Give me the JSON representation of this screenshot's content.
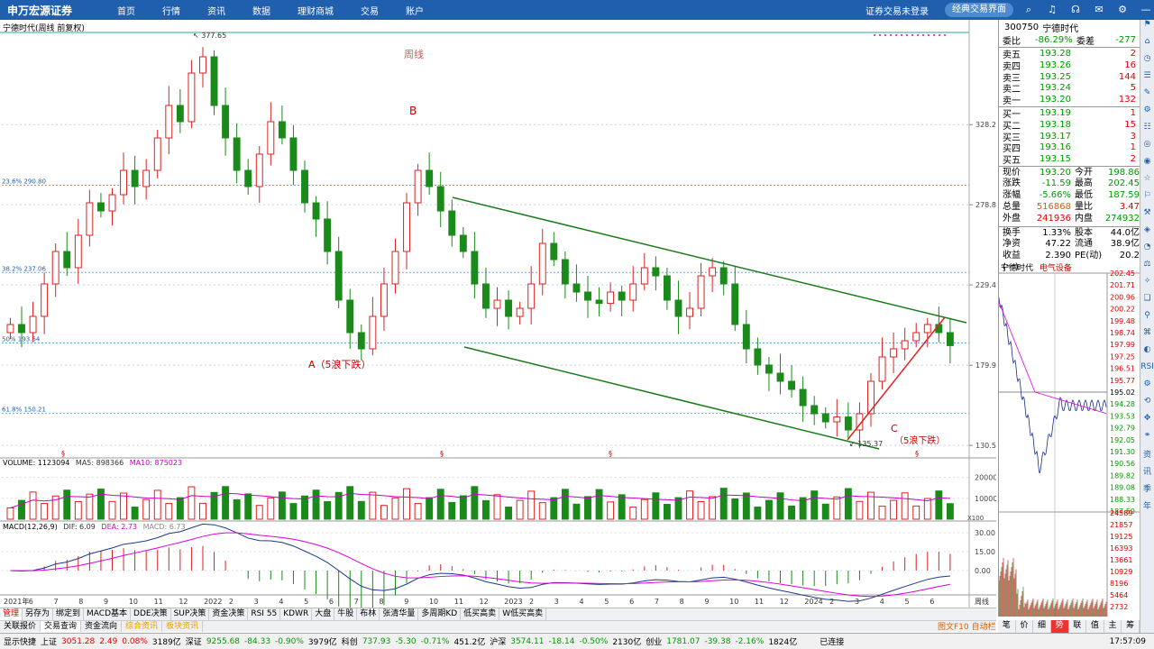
{
  "brand": {
    "logo": "申万宏源证券"
  },
  "nav": [
    "首页",
    "行情",
    "资讯",
    "数据",
    "理财商城",
    "交易",
    "账户"
  ],
  "topright": {
    "login": "证券交易未登录",
    "classic": "经典交易界面",
    "icons": [
      "search-icon",
      "bell-icon",
      "headset-icon",
      "mail-icon",
      "gear-icon",
      "minimize-icon",
      "restore-icon",
      "close-icon"
    ],
    "icon_glyphs": [
      "⌕",
      "♫",
      "☊",
      "✉",
      "⚙",
      "—",
      "▭",
      "✕"
    ]
  },
  "chart": {
    "title": "宁德时代(周线 前复权)",
    "period_label": "周线",
    "label_B": "B",
    "label_A": "A（5浪下跌）",
    "label_C": "C",
    "label_C_sub": "（5浪下跌）",
    "high_mark": "377.65",
    "low_mark": "135.37",
    "fib": [
      {
        "label": "23.6% 290.80",
        "value": 290.8
      },
      {
        "label": "38.2% 237.06",
        "value": 237.06
      },
      {
        "label": "50% 193.64",
        "value": 193.64
      },
      {
        "label": "61.8% 150.21",
        "value": 150.21
      }
    ],
    "yticks": [
      {
        "label": "328.2",
        "value": 328.2
      },
      {
        "label": "278.8",
        "value": 278.8
      },
      {
        "label": "229.4",
        "value": 229.4
      },
      {
        "label": "179.9",
        "value": 179.9
      },
      {
        "label": "130.5",
        "value": 130.5
      }
    ],
    "xticks": [
      "2021年",
      "6",
      "7",
      "8",
      "9",
      "10",
      "11",
      "12",
      "2022",
      "2",
      "3",
      "4",
      "5",
      "6",
      "7",
      "8",
      "9",
      "10",
      "11",
      "12",
      "2023",
      "2",
      "3",
      "4",
      "5",
      "6",
      "7",
      "8",
      "9",
      "10",
      "11",
      "12",
      "2024",
      "2",
      "3",
      "4",
      "5",
      "6"
    ],
    "x_unit": "周线",
    "volume": {
      "label": "VOLUME: 1123094",
      "ma5": "MA5: 898366",
      "ma10": "MA10: 875023",
      "yticks": [
        {
          "label": "20000",
          "value": 20000
        },
        {
          "label": "10000",
          "value": 10000
        }
      ],
      "unit": "X100"
    },
    "macd": {
      "label": "MACD(12,26,9)",
      "dif": "DIF: 6.09",
      "dea": "DEA: 2.73",
      "macd": "MACD: 6.73",
      "yticks": [
        {
          "label": "30.00",
          "value": 30
        },
        {
          "label": "15.00",
          "value": 15
        },
        {
          "label": "0.00",
          "value": 0
        }
      ]
    }
  },
  "chart_data": {
    "type": "candlestick",
    "title": "宁德时代(周线 前复权)",
    "ylim": [
      125,
      385
    ],
    "annotations": [
      {
        "text": "377.65",
        "kind": "high"
      },
      {
        "text": "135.37",
        "kind": "low"
      },
      {
        "text": "B"
      },
      {
        "text": "A（5浪下跌）"
      },
      {
        "text": "C（5浪下跌）"
      }
    ],
    "close_path": [
      205,
      200,
      210,
      230,
      250,
      240,
      260,
      280,
      275,
      285,
      300,
      290,
      300,
      320,
      340,
      330,
      360,
      370,
      340,
      320,
      300,
      290,
      310,
      330,
      320,
      300,
      280,
      270,
      250,
      220,
      200,
      190,
      210,
      230,
      250,
      280,
      300,
      290,
      275,
      260,
      250,
      230,
      215,
      220,
      210,
      215,
      230,
      255,
      245,
      230,
      225,
      220,
      218,
      225,
      220,
      230,
      240,
      235,
      220,
      210,
      215,
      235,
      240,
      230,
      205,
      190,
      180,
      175,
      170,
      165,
      155,
      150,
      145,
      148,
      140,
      150,
      170,
      185,
      190,
      195,
      200,
      205,
      200,
      192
    ]
  },
  "quote": {
    "code": "300750",
    "name": "宁德时代",
    "weibi_label": "委比",
    "weibi": "-86.29%",
    "weicha_label": "委差",
    "weicha": "-277",
    "asks": [
      {
        "label": "卖五",
        "price": "193.28",
        "vol": "2"
      },
      {
        "label": "卖四",
        "price": "193.26",
        "vol": "16"
      },
      {
        "label": "卖三",
        "price": "193.25",
        "vol": "144"
      },
      {
        "label": "卖二",
        "price": "193.24",
        "vol": "5"
      },
      {
        "label": "卖一",
        "price": "193.20",
        "vol": "132"
      }
    ],
    "bids": [
      {
        "label": "买一",
        "price": "193.19",
        "vol": "1"
      },
      {
        "label": "买二",
        "price": "193.18",
        "vol": "15"
      },
      {
        "label": "买三",
        "price": "193.17",
        "vol": "3"
      },
      {
        "label": "买四",
        "price": "193.16",
        "vol": "1"
      },
      {
        "label": "买五",
        "price": "193.15",
        "vol": "2"
      }
    ],
    "stats": [
      [
        "现价",
        "193.20",
        "今开",
        "198.86"
      ],
      [
        "涨跌",
        "-11.59",
        "最高",
        "202.45"
      ],
      [
        "涨幅",
        "-5.66%",
        "最低",
        "187.59"
      ],
      [
        "总量",
        "516868",
        "量比",
        "3.47"
      ],
      [
        "外盘",
        "241936",
        "内盘",
        "274932"
      ],
      [
        "换手",
        "1.33%",
        "股本",
        "44.0亿"
      ],
      [
        "净资",
        "47.22",
        "流通",
        "38.9亿"
      ],
      [
        "收益(一)",
        "2.390",
        "PE(动)",
        "20.2"
      ]
    ]
  },
  "mini": {
    "title": "宁德时代",
    "sector": "电气设备",
    "price_ticks": [
      "202.45",
      "201.71",
      "200.96",
      "200.22",
      "199.48",
      "198.74",
      "197.99",
      "197.25",
      "196.51",
      "195.77",
      "195.02",
      "194.28",
      "193.53",
      "192.79",
      "192.05",
      "191.30",
      "190.56",
      "189.82",
      "189.08",
      "188.33",
      "187.59"
    ],
    "vol_ticks": [
      "24589",
      "21857",
      "19125",
      "16393",
      "13661",
      "10929",
      "8196",
      "5464",
      "2732"
    ],
    "buttons": [
      "笔",
      "价",
      "细",
      "势",
      "联",
      "值",
      "主",
      "筹"
    ],
    "active": "势"
  },
  "tabs": [
    "管理",
    "另存为",
    "绑定到",
    "MACD基本",
    "DDE决策",
    "SUP决策",
    "资金决策",
    "RSI 55",
    "KDWR",
    "大盘",
    "牛股",
    "布林",
    "张清华量",
    "多周期KD",
    "低买高卖",
    "W低买高卖"
  ],
  "tabs2": [
    "关联报价",
    "交易查询",
    "资金流向",
    "综合资讯",
    "板块资讯"
  ],
  "bottomright": "图文F10  自动栏",
  "status": {
    "quick": "显示快捷",
    "sh_name": "上证",
    "sh": "3051.28",
    "sh_chg": "2.49",
    "sh_pct": "0.08%",
    "sh_amt": "3189亿",
    "sz_name": "深证",
    "sz": "9255.68",
    "sz_chg": "-84.33",
    "sz_pct": "-0.90%",
    "sz_amt": "3979亿",
    "kc_name": "科创",
    "kc": "737.93",
    "kc_chg": "-5.30",
    "kc_pct": "-0.71%",
    "kc_amt": "451.2亿",
    "hs_name": "沪深",
    "hs": "3574.11",
    "hs_chg": "-18.14",
    "hs_pct": "-0.50%",
    "hs_amt": "2130亿",
    "cy_name": "创业",
    "cy": "1781.07",
    "cy_chg": "-39.38",
    "cy_pct": "-2.16%",
    "cy_amt": "1824亿",
    "conn": "已连接",
    "time": "17:57:09"
  },
  "sidebar_glyphs": [
    "⚑",
    "⌂",
    "◷",
    "☰",
    "✎",
    "⚙",
    "☷",
    "◎",
    "◉",
    "☆",
    "⚐",
    "⚒",
    "◈",
    "◔",
    "⚖",
    "✧",
    "❏",
    "⚲",
    "⌘",
    "◐",
    "RSI",
    "⚙",
    "⟲",
    "✥",
    "⚭",
    "资",
    "讯",
    "季",
    "年"
  ]
}
